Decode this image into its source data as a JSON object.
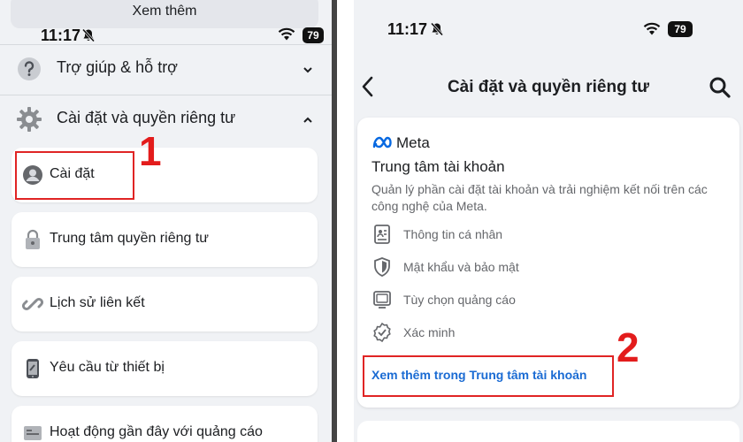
{
  "left_panel": {
    "see_more": "Xem thêm",
    "status": {
      "time": "11:17",
      "battery": "79"
    },
    "sections": [
      {
        "label": "Trợ giúp & hỗ trợ",
        "icon": "help-icon",
        "expanded": false
      },
      {
        "label": "Cài đặt và quyền riêng tư",
        "icon": "gear-icon",
        "expanded": true
      }
    ],
    "items": [
      {
        "label": "Cài đặt",
        "icon": "profile-icon"
      },
      {
        "label": "Trung tâm quyền riêng tư",
        "icon": "lock-icon"
      },
      {
        "label": "Lịch sử liên kết",
        "icon": "link-icon"
      },
      {
        "label": "Yêu cầu từ thiết bị",
        "icon": "phone-icon"
      },
      {
        "label": "Hoạt động gần đây với quảng cáo",
        "icon": "ad-icon"
      }
    ],
    "step_number": "1"
  },
  "right_panel": {
    "status": {
      "time": "11:17",
      "battery": "79"
    },
    "title": "Cài đặt và quyền riêng tư",
    "accounts_card": {
      "brand": "Meta",
      "heading": "Trung tâm tài khoản",
      "description": "Quản lý phần cài đặt tài khoản và trải nghiệm kết nối trên các công nghệ của Meta.",
      "items": [
        {
          "label": "Thông tin cá nhân",
          "icon": "id-card-icon"
        },
        {
          "label": "Mật khẩu và bảo mật",
          "icon": "shield-icon"
        },
        {
          "label": "Tùy chọn quảng cáo",
          "icon": "monitor-icon"
        },
        {
          "label": "Xác minh",
          "icon": "verified-badge-icon"
        }
      ],
      "link": "Xem thêm trong Trung tâm tài khoản"
    },
    "step_number": "2"
  },
  "colors": {
    "highlight": "#e02424",
    "link": "#1a6bd3",
    "background": "#f0f2f5"
  }
}
